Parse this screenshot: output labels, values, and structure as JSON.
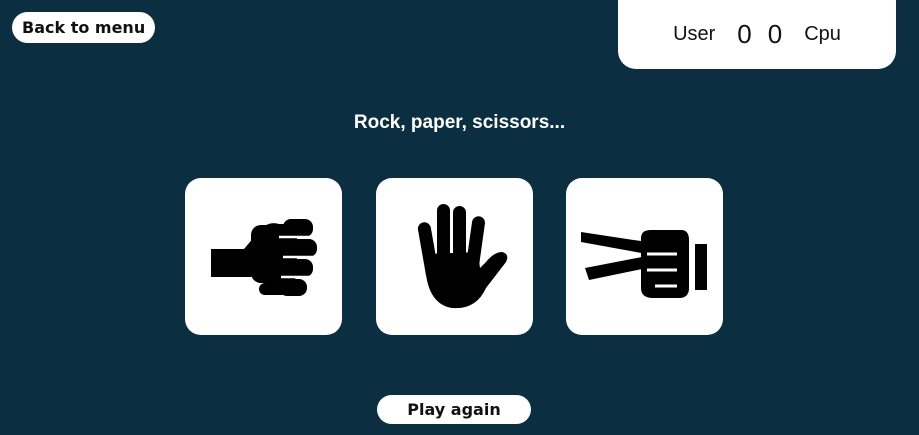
{
  "nav": {
    "back_label": "Back to menu"
  },
  "scoreboard": {
    "user_label": "User",
    "user_score": "0",
    "cpu_score": "0",
    "cpu_label": "Cpu"
  },
  "game": {
    "prompt": "Rock, paper, scissors...",
    "choices": [
      {
        "id": "rock",
        "icon": "fist-icon"
      },
      {
        "id": "paper",
        "icon": "open-hand-icon"
      },
      {
        "id": "scissors",
        "icon": "scissors-hand-icon"
      }
    ],
    "play_again_label": "Play again"
  },
  "colors": {
    "background": "#0b2e40",
    "card": "#ffffff",
    "text": "#111111",
    "prompt_text": "#ffffff"
  }
}
